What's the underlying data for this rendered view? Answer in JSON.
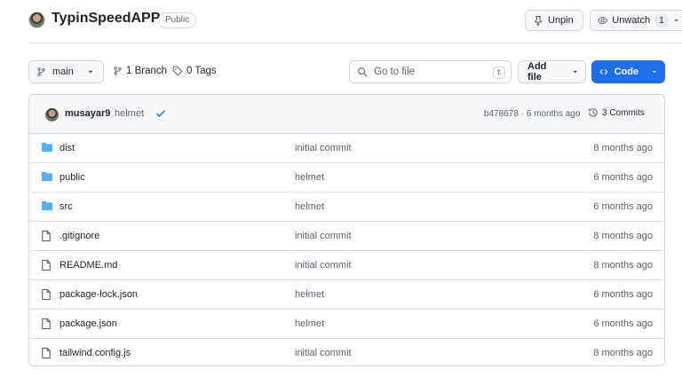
{
  "repo": {
    "name": "TypinSpeedAPP",
    "visibility": "Public",
    "unpin_label": "Unpin",
    "unwatch_label": "Unwatch",
    "watch_count": "1"
  },
  "toolbar": {
    "branch": "main",
    "branches": "1 Branch",
    "tags": "0 Tags",
    "search_placeholder": "Go to file",
    "search_shortcut": "t",
    "add_file_label": "Add file",
    "code_label": "Code"
  },
  "latest_commit": {
    "author": "musayar9",
    "message": "helmet",
    "sha_age": "b478678 · 6 months ago",
    "commits": "3 Commits"
  },
  "files": [
    {
      "name": "dist",
      "type": "folder",
      "commit": "initial commit",
      "age": "8 months ago"
    },
    {
      "name": "public",
      "type": "folder",
      "commit": "helmet",
      "age": "6 months ago"
    },
    {
      "name": "src",
      "type": "folder",
      "commit": "helmet",
      "age": "6 months ago"
    },
    {
      "name": ".gitignore",
      "type": "file",
      "commit": "initial commit",
      "age": "8 months ago"
    },
    {
      "name": "README.md",
      "type": "file",
      "commit": "initial commit",
      "age": "8 months ago"
    },
    {
      "name": "package-lock.json",
      "type": "file",
      "commit": "helmet",
      "age": "6 months ago"
    },
    {
      "name": "package.json",
      "type": "file",
      "commit": "helmet",
      "age": "6 months ago"
    },
    {
      "name": "tailwind.config.js",
      "type": "file",
      "commit": "initial commit",
      "age": "8 months ago"
    }
  ],
  "colors": {
    "accent": "#1f6feb",
    "folder": "#54aeff",
    "muted_text": "#59636e",
    "border": "#d0d7de"
  }
}
